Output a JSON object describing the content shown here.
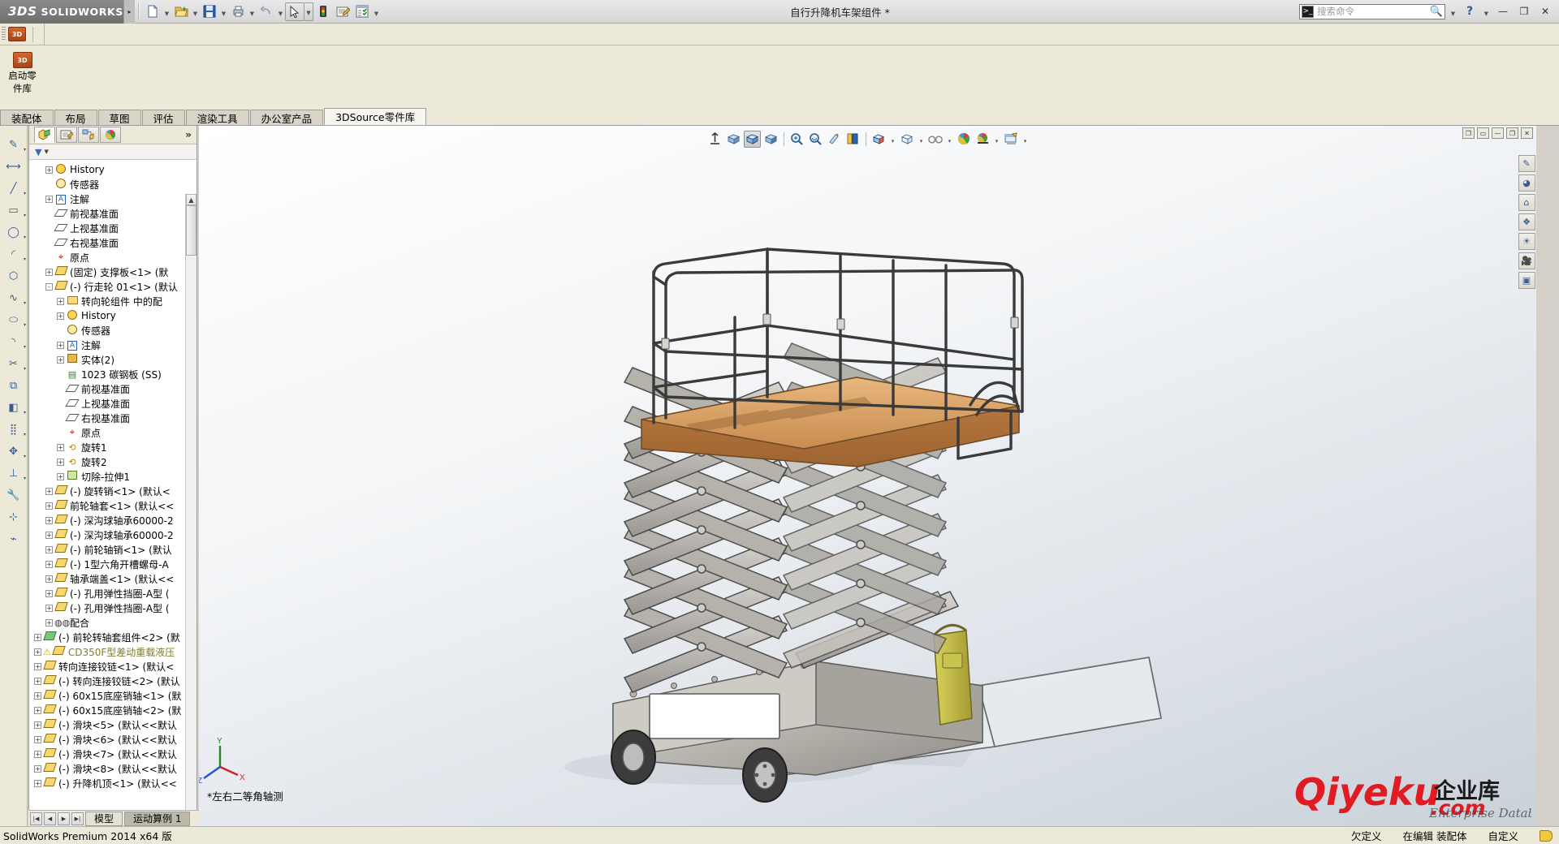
{
  "window": {
    "title": "自行升降机车架组件 *",
    "brand_ds": "3DS",
    "brand_name": "SOLIDWORKS",
    "minimize": "—",
    "maximize": "❐",
    "close": "✕",
    "help": "?"
  },
  "search": {
    "placeholder": "搜索命令",
    "icon": "command-search-icon",
    "value": ""
  },
  "quick_toolbar": [
    {
      "name": "new-document",
      "glyph": "📄",
      "caret": true
    },
    {
      "name": "open-document",
      "glyph": "📂",
      "caret": true
    },
    {
      "name": "save-document",
      "glyph": "💾",
      "caret": true
    },
    {
      "name": "print-document",
      "glyph": "🖨",
      "caret": true
    },
    {
      "name": "undo",
      "glyph": "↰",
      "caret": true
    },
    {
      "name": "select-pointer",
      "glyph": "➤",
      "caret": true,
      "selected": true
    },
    {
      "name": "rebuild-traffic-light",
      "glyph": "🚦",
      "caret": false
    },
    {
      "name": "options-edit",
      "glyph": "📝",
      "caret": false
    },
    {
      "name": "options-settings",
      "glyph": "📋",
      "caret": true
    }
  ],
  "launch_panel": {
    "label_line1": "启动零",
    "label_line2": "件库",
    "icon": "3d-source-icon",
    "icon_text": "3D"
  },
  "ribbon_tabs": [
    {
      "label": "装配体",
      "active": false
    },
    {
      "label": "布局",
      "active": false
    },
    {
      "label": "草图",
      "active": false
    },
    {
      "label": "评估",
      "active": false
    },
    {
      "label": "渲染工具",
      "active": false
    },
    {
      "label": "办公室产品",
      "active": false
    },
    {
      "label": "3DSource零件库",
      "active": true
    }
  ],
  "left_tools": [
    {
      "name": "sketch-tool",
      "glyph": "✎",
      "caret": true
    },
    {
      "name": "smart-dimension-tool",
      "glyph": "⟷",
      "caret": false
    },
    {
      "name": "line-tool",
      "glyph": "╱",
      "caret": true
    },
    {
      "name": "rectangle-tool",
      "glyph": "▭",
      "caret": true
    },
    {
      "name": "circle-tool",
      "glyph": "◯",
      "caret": true
    },
    {
      "name": "arc-tool",
      "glyph": "◜",
      "caret": true
    },
    {
      "name": "polygon-tool",
      "glyph": "⬡",
      "caret": false
    },
    {
      "name": "spline-tool",
      "glyph": "∿",
      "caret": true
    },
    {
      "name": "ellipse-tool",
      "glyph": "⬭",
      "caret": true
    },
    {
      "name": "fillet-tool",
      "glyph": "◝",
      "caret": true
    },
    {
      "name": "trim-tool",
      "glyph": "✂",
      "caret": true
    },
    {
      "name": "offset-tool",
      "glyph": "⧉",
      "caret": false
    },
    {
      "name": "mirror-tool",
      "glyph": "◧",
      "caret": true
    },
    {
      "name": "linear-pattern-tool",
      "glyph": "⣿",
      "caret": true
    },
    {
      "name": "move-entities-tool",
      "glyph": "✥",
      "caret": true
    },
    {
      "name": "display-delete-relations",
      "glyph": "⊥",
      "caret": true
    },
    {
      "name": "repair-sketch-tool",
      "glyph": "🔧",
      "caret": false
    },
    {
      "name": "quick-snaps-tool",
      "glyph": "⊹",
      "caret": false
    },
    {
      "name": "rapid-sketch-tool",
      "glyph": "⌁",
      "caret": false
    }
  ],
  "feature_manager": {
    "tabs": [
      {
        "name": "feature-tree-tab",
        "glyph": "▤",
        "active": true
      },
      {
        "name": "property-manager-tab",
        "glyph": "📝",
        "active": false
      },
      {
        "name": "configuration-manager-tab",
        "glyph": "⛁",
        "active": false
      },
      {
        "name": "display-manager-tab",
        "glyph": "◕",
        "active": false
      }
    ],
    "expand_icon": "»",
    "filter_placeholder": "",
    "filter_icon": "filter-funnel-icon",
    "tree": [
      {
        "label": "History",
        "indent": 1,
        "expand": "+",
        "icon": "hist"
      },
      {
        "label": "传感器",
        "indent": 1,
        "expand": "",
        "icon": "sens"
      },
      {
        "label": "注解",
        "indent": 1,
        "expand": "+",
        "icon": "note"
      },
      {
        "label": "前视基准面",
        "indent": 1,
        "expand": "",
        "icon": "plane"
      },
      {
        "label": "上视基准面",
        "indent": 1,
        "expand": "",
        "icon": "plane"
      },
      {
        "label": "右视基准面",
        "indent": 1,
        "expand": "",
        "icon": "plane"
      },
      {
        "label": "原点",
        "indent": 1,
        "expand": "",
        "icon": "origin"
      },
      {
        "label": "(固定) 支撑板<1> (默",
        "indent": 1,
        "expand": "+",
        "icon": "part"
      },
      {
        "label": "(-) 行走轮 01<1> (默认",
        "indent": 1,
        "expand": "-",
        "icon": "part"
      },
      {
        "label": "转向轮组件 中的配",
        "indent": 2,
        "expand": "+",
        "icon": "folder"
      },
      {
        "label": "History",
        "indent": 2,
        "expand": "+",
        "icon": "hist"
      },
      {
        "label": "传感器",
        "indent": 2,
        "expand": "",
        "icon": "sens"
      },
      {
        "label": "注解",
        "indent": 2,
        "expand": "+",
        "icon": "note"
      },
      {
        "label": "实体(2)",
        "indent": 2,
        "expand": "+",
        "icon": "solid"
      },
      {
        "label": "1023 碳钢板 (SS)",
        "indent": 2,
        "expand": "",
        "icon": "mtl"
      },
      {
        "label": "前视基准面",
        "indent": 2,
        "expand": "",
        "icon": "plane"
      },
      {
        "label": "上视基准面",
        "indent": 2,
        "expand": "",
        "icon": "plane"
      },
      {
        "label": "右视基准面",
        "indent": 2,
        "expand": "",
        "icon": "plane"
      },
      {
        "label": "原点",
        "indent": 2,
        "expand": "",
        "icon": "origin"
      },
      {
        "label": "旋转1",
        "indent": 2,
        "expand": "+",
        "icon": "rev"
      },
      {
        "label": "旋转2",
        "indent": 2,
        "expand": "+",
        "icon": "rev"
      },
      {
        "label": "切除-拉伸1",
        "indent": 2,
        "expand": "+",
        "icon": "cut"
      },
      {
        "label": "(-) 旋转销<1> (默认<",
        "indent": 1,
        "expand": "+",
        "icon": "part"
      },
      {
        "label": "前轮轴套<1> (默认<<",
        "indent": 1,
        "expand": "+",
        "icon": "part"
      },
      {
        "label": "(-) 深沟球轴承60000-2",
        "indent": 1,
        "expand": "+",
        "icon": "part"
      },
      {
        "label": "(-) 深沟球轴承60000-2",
        "indent": 1,
        "expand": "+",
        "icon": "part"
      },
      {
        "label": "(-) 前轮轴销<1> (默认",
        "indent": 1,
        "expand": "+",
        "icon": "part"
      },
      {
        "label": "(-) 1型六角开槽螺母-A",
        "indent": 1,
        "expand": "+",
        "icon": "part"
      },
      {
        "label": "轴承端盖<1> (默认<<",
        "indent": 1,
        "expand": "+",
        "icon": "part"
      },
      {
        "label": "(-) 孔用弹性挡圈-A型 (",
        "indent": 1,
        "expand": "+",
        "icon": "part"
      },
      {
        "label": "(-) 孔用弹性挡圈-A型 (",
        "indent": 1,
        "expand": "+",
        "icon": "part"
      },
      {
        "label": "配合",
        "indent": 1,
        "expand": "+",
        "icon": "mate"
      },
      {
        "label": "(-) 前轮转轴套组件<2> (默",
        "indent": 0,
        "expand": "+",
        "icon": "green"
      },
      {
        "label": "CD350F型差动重载液压",
        "indent": 0,
        "expand": "+",
        "icon": "part",
        "warn": true
      },
      {
        "label": "转向连接铰链<1> (默认<",
        "indent": 0,
        "expand": "+",
        "icon": "part"
      },
      {
        "label": "(-) 转向连接铰链<2> (默认",
        "indent": 0,
        "expand": "+",
        "icon": "part"
      },
      {
        "label": "(-) 60x15底座销轴<1> (默",
        "indent": 0,
        "expand": "+",
        "icon": "part"
      },
      {
        "label": "(-) 60x15底座销轴<2> (默",
        "indent": 0,
        "expand": "+",
        "icon": "part"
      },
      {
        "label": "(-) 滑块<5> (默认<<默认",
        "indent": 0,
        "expand": "+",
        "icon": "part"
      },
      {
        "label": "(-) 滑块<6> (默认<<默认",
        "indent": 0,
        "expand": "+",
        "icon": "part"
      },
      {
        "label": "(-) 滑块<7> (默认<<默认",
        "indent": 0,
        "expand": "+",
        "icon": "part"
      },
      {
        "label": "(-) 滑块<8> (默认<<默认",
        "indent": 0,
        "expand": "+",
        "icon": "part"
      },
      {
        "label": "(-) 升降机顶<1> (默认<<",
        "indent": 0,
        "expand": "+",
        "icon": "part"
      }
    ]
  },
  "model_tabs": {
    "nav": [
      "|◀",
      "◀",
      "▶",
      "▶|"
    ],
    "tabs": [
      {
        "label": "模型",
        "active": false
      },
      {
        "label": "运动算例 1",
        "active": true
      }
    ]
  },
  "viewport": {
    "toolbar": [
      {
        "name": "zoom-to-fit-icon",
        "glyph": "⤒",
        "caret": false
      },
      {
        "name": "zoom-to-area-icon",
        "glyph": "◱",
        "caret": false
      },
      {
        "name": "previous-view-icon",
        "glyph": "◰",
        "caret": false,
        "selected": true
      },
      {
        "name": "section-view-icon",
        "glyph": "◲",
        "caret": false
      },
      {
        "name": "zoom-in-out-icon",
        "glyph": "⌕",
        "caret": false
      },
      {
        "name": "rotate-view-icon",
        "glyph": "⟳",
        "caret": false
      },
      {
        "name": "pan-view-icon",
        "glyph": "✥",
        "caret": false
      },
      {
        "name": "view-orientation-icon",
        "glyph": "▥",
        "caret": false
      },
      {
        "name": "display-style-icon",
        "glyph": "◩",
        "caret": true
      },
      {
        "name": "hide-show-items-icon",
        "glyph": "◻",
        "caret": true
      },
      {
        "name": "view-settings-icon",
        "glyph": "👓",
        "caret": true
      },
      {
        "name": "apply-scene-icon",
        "glyph": "◕",
        "caret": false
      },
      {
        "name": "view-setting-sphere-icon",
        "glyph": "◕",
        "caret": true
      },
      {
        "name": "viewport-layout-icon",
        "glyph": "🖵",
        "caret": true
      }
    ],
    "window_buttons": [
      "❐",
      "▭",
      "—",
      "❐",
      "✕"
    ],
    "right_tools": [
      {
        "name": "swift-annotation-icon",
        "glyph": "✎"
      },
      {
        "name": "appearances-icon",
        "glyph": "◕"
      },
      {
        "name": "scenes-icon",
        "glyph": "⌂"
      },
      {
        "name": "decals-icon",
        "glyph": "❖"
      },
      {
        "name": "lights-icon",
        "glyph": "☀"
      },
      {
        "name": "cameras-icon",
        "glyph": "🎥"
      },
      {
        "name": "walkthrough-icon",
        "glyph": "▣"
      }
    ],
    "view_label": "*左右二等角轴测",
    "triad": {
      "x": "X",
      "y": "Y",
      "z": "Z"
    }
  },
  "watermark": {
    "main": "Qiyeku",
    "dotcom": ".com",
    "cn": "企业库",
    "sub": "Enterprise Database"
  },
  "statusbar": {
    "left": "SolidWorks Premium 2014 x64 版",
    "items": [
      "欠定义",
      "在编辑  装配体",
      "自定义"
    ],
    "tag_icon": "tag-icon"
  }
}
